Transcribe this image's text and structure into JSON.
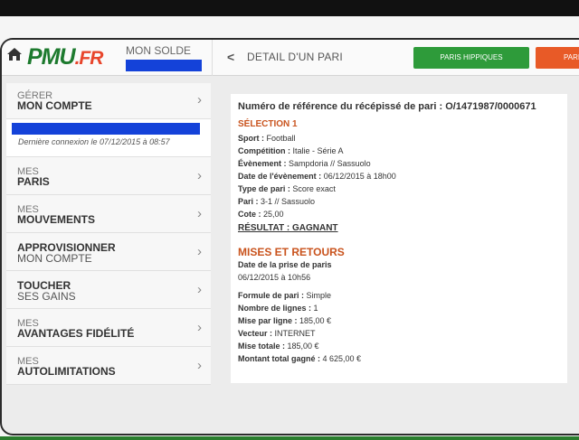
{
  "header": {
    "logo_main": "PMU",
    "logo_suffix": ".FR",
    "solde_label": "MON SOLDE",
    "back_icon": "chevron-left-icon",
    "title": "DETAIL D'UN PARI",
    "btn_hippiques": "PARIS HIPPIQUES",
    "btn_sport": "PARIS",
    "colors": {
      "pmu_green": "#1d7a2e",
      "fr_red": "#e8452b",
      "hippiques_green": "#2e9b3a",
      "sport_orange": "#e85a27",
      "redaction_blue": "#1442d9"
    }
  },
  "sidebar": {
    "gerer_small": "GÉRER",
    "gerer_big": "MON COMPTE",
    "last_connection": "Dernière connexion le 07/12/2015 à 08:57",
    "items": [
      {
        "small": "MES",
        "big": "PARIS"
      },
      {
        "small": "MES",
        "big": "MOUVEMENTS"
      },
      {
        "big": "APPROVISIONNER",
        "big2": "MON COMPTE"
      },
      {
        "big": "TOUCHER",
        "big2": "SES GAINS"
      },
      {
        "small": "MES",
        "big": "AVANTAGES FIDÉLITÉ"
      },
      {
        "small": "MES",
        "big": "AUTOLIMITATIONS"
      }
    ]
  },
  "detail": {
    "reference": "Numéro de référence du récépissé de pari : O/1471987/0000671",
    "selection_title": "SÉLECTION 1",
    "sport_label": "Sport :",
    "sport_value": "Football",
    "competition_label": "Compétition :",
    "competition_value": "Italie - Série A",
    "evenement_label": "Évènement :",
    "evenement_value": "Sampdoria // Sassuolo",
    "date_event_label": "Date de l'évènement :",
    "date_event_value": "06/12/2015 à 18h00",
    "type_label": "Type de pari :",
    "type_value": "Score exact",
    "pari_label": "Pari :",
    "pari_value": "3-1 // Sassuolo",
    "cote_label": "Cote :",
    "cote_value": "25,00",
    "result": "RÉSULTAT : GAGNANT",
    "mises_title": "MISES ET RETOURS",
    "prise_label": "Date de la prise de paris",
    "prise_value": "06/12/2015 à 10h56",
    "formule_label": "Formule de pari :",
    "formule_value": "Simple",
    "lignes_label": "Nombre de lignes :",
    "lignes_value": "1",
    "mise_ligne_label": "Mise par ligne :",
    "mise_ligne_value": "185,00 €",
    "vecteur_label": "Vecteur :",
    "vecteur_value": "INTERNET",
    "mise_totale_label": "Mise totale :",
    "mise_totale_value": "185,00 €",
    "montant_label": "Montant total gagné :",
    "montant_value": "4 625,00 €"
  }
}
